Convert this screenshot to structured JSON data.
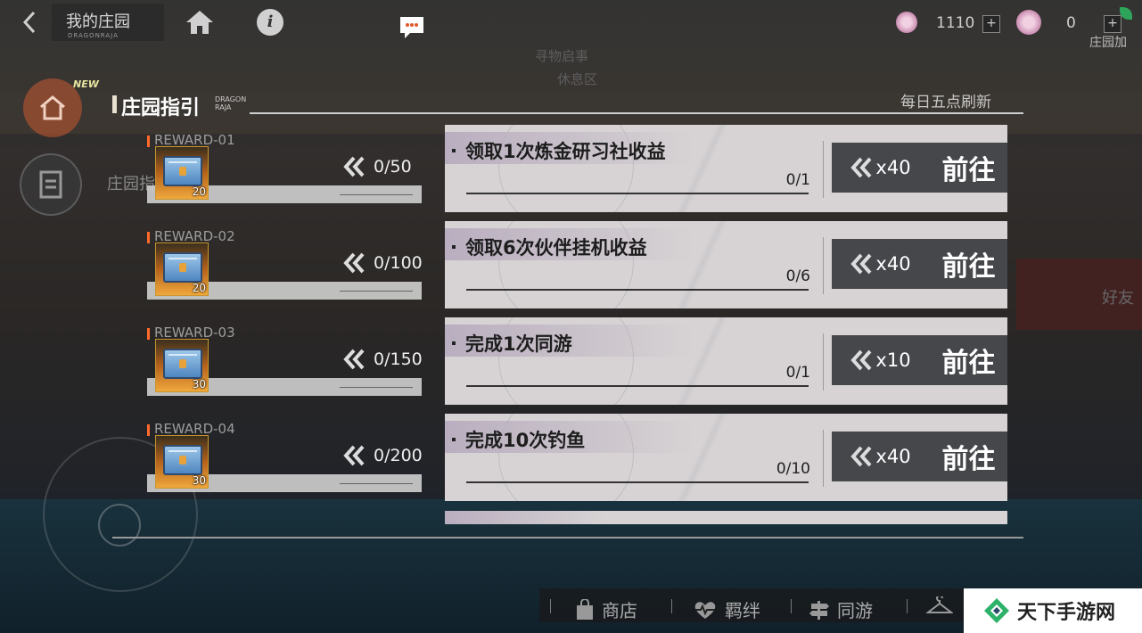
{
  "topbar": {
    "title": "我的庄园",
    "subtitle": "DRAGONRAJA",
    "currency_1_value": "1110",
    "currency_2_value": "0",
    "plus_label": "+",
    "right_edge_label": "庄园加",
    "info_label": "i"
  },
  "background": {
    "sign_1": "寻物启事",
    "sign_2": "休息区",
    "side_label": "庄园指",
    "right_label": "好友",
    "new_badge": "NEW"
  },
  "panel": {
    "title": "庄园指引",
    "logo_line1": "DRAGON",
    "logo_line2": "RAJA",
    "refresh_text": "每日五点刷新"
  },
  "rewards": [
    {
      "label": "REWARD-01",
      "quantity": "20",
      "progress": "0/50"
    },
    {
      "label": "REWARD-02",
      "quantity": "20",
      "progress": "0/100"
    },
    {
      "label": "REWARD-03",
      "quantity": "30",
      "progress": "0/150"
    },
    {
      "label": "REWARD-04",
      "quantity": "30",
      "progress": "0/200"
    }
  ],
  "tasks": [
    {
      "title": "领取1次炼金研习社收益",
      "progress": "0/1",
      "reward": "x40",
      "go_label": "前往"
    },
    {
      "title": "领取6次伙伴挂机收益",
      "progress": "0/6",
      "reward": "x40",
      "go_label": "前往"
    },
    {
      "title": "完成1次同游",
      "progress": "0/1",
      "reward": "x10",
      "go_label": "前往"
    },
    {
      "title": "完成10次钓鱼",
      "progress": "0/10",
      "reward": "x40",
      "go_label": "前往"
    }
  ],
  "bottom_nav": [
    {
      "label": "商店",
      "icon": "shop-bag-icon"
    },
    {
      "label": "羁绊",
      "icon": "heart-pulse-icon"
    },
    {
      "label": "同游",
      "icon": "signpost-icon"
    }
  ],
  "watermark": {
    "text": "天下手游网"
  },
  "colors": {
    "accent_orange": "#ff6a2a",
    "task_bg": "#d7d3d4",
    "task_button_bg": "#45474b",
    "highlight_purple": "#b9aebf"
  }
}
